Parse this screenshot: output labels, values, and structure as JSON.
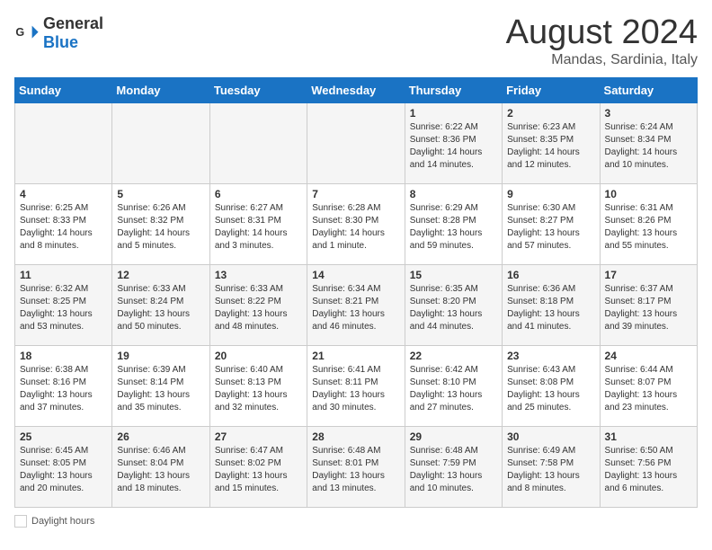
{
  "header": {
    "logo_general": "General",
    "logo_blue": "Blue",
    "month_year": "August 2024",
    "location": "Mandas, Sardinia, Italy"
  },
  "days_of_week": [
    "Sunday",
    "Monday",
    "Tuesday",
    "Wednesday",
    "Thursday",
    "Friday",
    "Saturday"
  ],
  "weeks": [
    [
      {
        "day": "",
        "info": ""
      },
      {
        "day": "",
        "info": ""
      },
      {
        "day": "",
        "info": ""
      },
      {
        "day": "",
        "info": ""
      },
      {
        "day": "1",
        "info": "Sunrise: 6:22 AM\nSunset: 8:36 PM\nDaylight: 14 hours and 14 minutes."
      },
      {
        "day": "2",
        "info": "Sunrise: 6:23 AM\nSunset: 8:35 PM\nDaylight: 14 hours and 12 minutes."
      },
      {
        "day": "3",
        "info": "Sunrise: 6:24 AM\nSunset: 8:34 PM\nDaylight: 14 hours and 10 minutes."
      }
    ],
    [
      {
        "day": "4",
        "info": "Sunrise: 6:25 AM\nSunset: 8:33 PM\nDaylight: 14 hours and 8 minutes."
      },
      {
        "day": "5",
        "info": "Sunrise: 6:26 AM\nSunset: 8:32 PM\nDaylight: 14 hours and 5 minutes."
      },
      {
        "day": "6",
        "info": "Sunrise: 6:27 AM\nSunset: 8:31 PM\nDaylight: 14 hours and 3 minutes."
      },
      {
        "day": "7",
        "info": "Sunrise: 6:28 AM\nSunset: 8:30 PM\nDaylight: 14 hours and 1 minute."
      },
      {
        "day": "8",
        "info": "Sunrise: 6:29 AM\nSunset: 8:28 PM\nDaylight: 13 hours and 59 minutes."
      },
      {
        "day": "9",
        "info": "Sunrise: 6:30 AM\nSunset: 8:27 PM\nDaylight: 13 hours and 57 minutes."
      },
      {
        "day": "10",
        "info": "Sunrise: 6:31 AM\nSunset: 8:26 PM\nDaylight: 13 hours and 55 minutes."
      }
    ],
    [
      {
        "day": "11",
        "info": "Sunrise: 6:32 AM\nSunset: 8:25 PM\nDaylight: 13 hours and 53 minutes."
      },
      {
        "day": "12",
        "info": "Sunrise: 6:33 AM\nSunset: 8:24 PM\nDaylight: 13 hours and 50 minutes."
      },
      {
        "day": "13",
        "info": "Sunrise: 6:33 AM\nSunset: 8:22 PM\nDaylight: 13 hours and 48 minutes."
      },
      {
        "day": "14",
        "info": "Sunrise: 6:34 AM\nSunset: 8:21 PM\nDaylight: 13 hours and 46 minutes."
      },
      {
        "day": "15",
        "info": "Sunrise: 6:35 AM\nSunset: 8:20 PM\nDaylight: 13 hours and 44 minutes."
      },
      {
        "day": "16",
        "info": "Sunrise: 6:36 AM\nSunset: 8:18 PM\nDaylight: 13 hours and 41 minutes."
      },
      {
        "day": "17",
        "info": "Sunrise: 6:37 AM\nSunset: 8:17 PM\nDaylight: 13 hours and 39 minutes."
      }
    ],
    [
      {
        "day": "18",
        "info": "Sunrise: 6:38 AM\nSunset: 8:16 PM\nDaylight: 13 hours and 37 minutes."
      },
      {
        "day": "19",
        "info": "Sunrise: 6:39 AM\nSunset: 8:14 PM\nDaylight: 13 hours and 35 minutes."
      },
      {
        "day": "20",
        "info": "Sunrise: 6:40 AM\nSunset: 8:13 PM\nDaylight: 13 hours and 32 minutes."
      },
      {
        "day": "21",
        "info": "Sunrise: 6:41 AM\nSunset: 8:11 PM\nDaylight: 13 hours and 30 minutes."
      },
      {
        "day": "22",
        "info": "Sunrise: 6:42 AM\nSunset: 8:10 PM\nDaylight: 13 hours and 27 minutes."
      },
      {
        "day": "23",
        "info": "Sunrise: 6:43 AM\nSunset: 8:08 PM\nDaylight: 13 hours and 25 minutes."
      },
      {
        "day": "24",
        "info": "Sunrise: 6:44 AM\nSunset: 8:07 PM\nDaylight: 13 hours and 23 minutes."
      }
    ],
    [
      {
        "day": "25",
        "info": "Sunrise: 6:45 AM\nSunset: 8:05 PM\nDaylight: 13 hours and 20 minutes."
      },
      {
        "day": "26",
        "info": "Sunrise: 6:46 AM\nSunset: 8:04 PM\nDaylight: 13 hours and 18 minutes."
      },
      {
        "day": "27",
        "info": "Sunrise: 6:47 AM\nSunset: 8:02 PM\nDaylight: 13 hours and 15 minutes."
      },
      {
        "day": "28",
        "info": "Sunrise: 6:48 AM\nSunset: 8:01 PM\nDaylight: 13 hours and 13 minutes."
      },
      {
        "day": "29",
        "info": "Sunrise: 6:48 AM\nSunset: 7:59 PM\nDaylight: 13 hours and 10 minutes."
      },
      {
        "day": "30",
        "info": "Sunrise: 6:49 AM\nSunset: 7:58 PM\nDaylight: 13 hours and 8 minutes."
      },
      {
        "day": "31",
        "info": "Sunrise: 6:50 AM\nSunset: 7:56 PM\nDaylight: 13 hours and 6 minutes."
      }
    ]
  ],
  "legend": {
    "daylight_label": "Daylight hours"
  }
}
